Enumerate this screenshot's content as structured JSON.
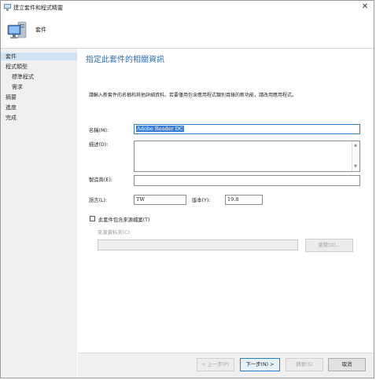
{
  "window": {
    "title": "建立套件和程式精靈"
  },
  "header": {
    "title": "套件"
  },
  "sidebar": {
    "items": [
      {
        "label": "套件"
      },
      {
        "label": "程式類型"
      },
      {
        "label": "標準程式"
      },
      {
        "label": "需求"
      },
      {
        "label": "摘要"
      },
      {
        "label": "進度"
      },
      {
        "label": "完成"
      }
    ]
  },
  "main": {
    "title": "指定此套件的相關資訊",
    "description": "請輸入新套件的名稱和其他詳細資料。若要僅用包含應用程式類別目錄的新功能，請改用應用程式。",
    "name_label": "名稱(M):",
    "name_value": "Adobe Reader DC",
    "description_label": "描述(D):",
    "description_value": "",
    "manufacturer_label": "製造商(E):",
    "manufacturer_value": "",
    "language_label": "語言(L):",
    "language_value": "TW",
    "version_label": "版本(Y):",
    "version_value": "19.8",
    "source_checkbox_label": "此套件包含來源檔案(T)",
    "source_folder_label": "來源資料夾(C):",
    "source_folder_value": "",
    "browse_label": "瀏覽(O)..."
  },
  "footer": {
    "prev_label": "< 上一步(P)",
    "next_label": "下一步(N) >",
    "summary_label": "摘要(S)",
    "cancel_label": "取消"
  }
}
